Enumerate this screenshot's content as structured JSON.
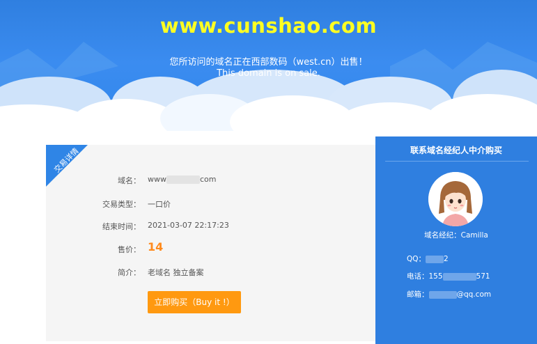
{
  "hero": {
    "domain": "www.cunshao.com",
    "notice_cn": "您所访问的域名正在西部数码（west.cn）出售！",
    "notice_en": "This domain is on sale."
  },
  "trade": {
    "ribbon": "交易详情",
    "domain_label": "域名：",
    "domain_value_start": "www",
    "domain_value_end": "com",
    "type_label": "交易类型：",
    "type_value": "一口价",
    "end_label": "结束时间：",
    "end_value": "2021-03-07 22:17:23",
    "price_label": "售价：",
    "price_value": "14",
    "desc_label": "简介：",
    "desc_value": "老域名 独立备案",
    "buy_label": "立即购买（Buy it !）"
  },
  "broker": {
    "title": "联系域名经纪人中介购买",
    "name": "域名经纪：Camilla",
    "qq_label": "QQ：",
    "qq_end": "2",
    "phone_label": "电话：",
    "phone_start": "155",
    "phone_end": "571",
    "email_label": "邮箱：",
    "email_end": "@qq.com"
  },
  "colors": {
    "hero_blue": "#2f7fe0",
    "title_yellow": "#ffff22",
    "price_orange": "#ff8a1c",
    "button_orange": "#ff9910"
  }
}
